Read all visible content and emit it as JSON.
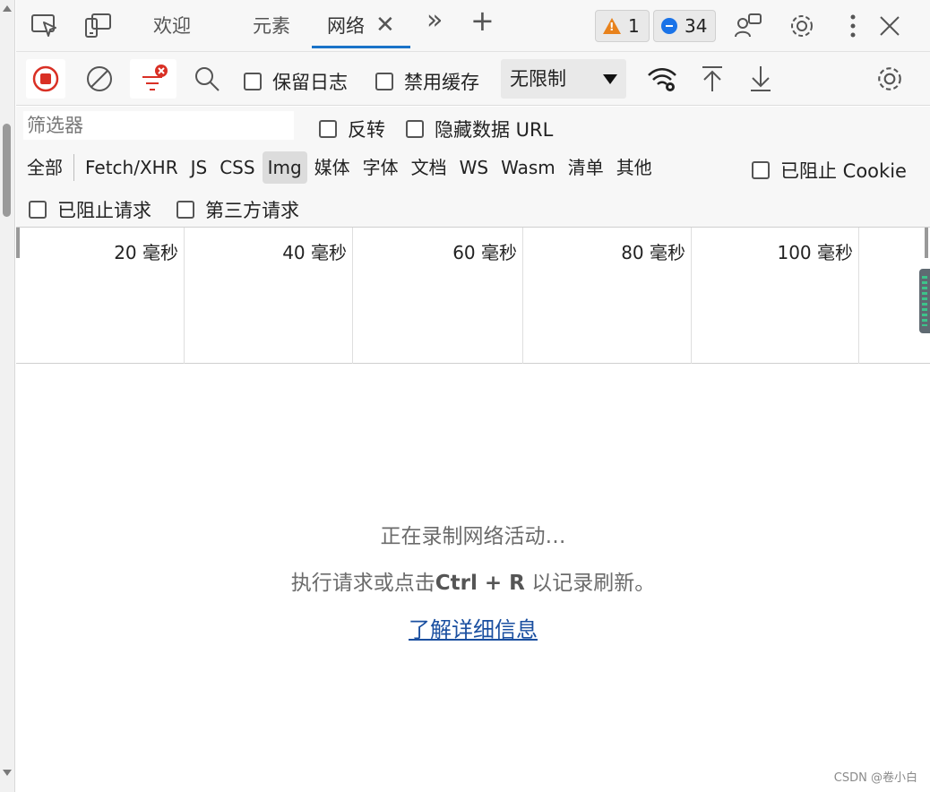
{
  "tabs": {
    "welcome": "欢迎",
    "elements": "元素",
    "network": "网络",
    "close_glyph": "✕",
    "more_glyph": "»",
    "add_glyph": "+"
  },
  "badges": {
    "warnings": "1",
    "messages": "34"
  },
  "toolbar": {
    "preserve_log": "保留日志",
    "disable_cache": "禁用缓存",
    "throttle": "无限制"
  },
  "filter": {
    "placeholder": "筛选器",
    "invert": "反转",
    "hide_data_urls": "隐藏数据 URL",
    "types": [
      "全部",
      "Fetch/XHR",
      "JS",
      "CSS",
      "Img",
      "媒体",
      "字体",
      "文档",
      "WS",
      "Wasm",
      "清单",
      "其他"
    ],
    "selected_type": "Img",
    "blocked_cookies": "已阻止 Cookie",
    "blocked_requests": "已阻止请求",
    "third_party": "第三方请求"
  },
  "overview": {
    "ticks": [
      "20 毫秒",
      "40 毫秒",
      "60 毫秒",
      "80 毫秒",
      "100 毫秒"
    ]
  },
  "empty": {
    "recording": "正在录制网络活动…",
    "hint_before": "执行请求或点击",
    "hint_shortcut": "Ctrl + R",
    "hint_after": " 以记录刷新。",
    "learn_more": "了解详细信息"
  },
  "watermark": "CSDN @卷小白",
  "colors": {
    "accent": "#1a73c8",
    "record": "#d93025",
    "warning": "#e8821c",
    "link": "#1a4fa0"
  }
}
